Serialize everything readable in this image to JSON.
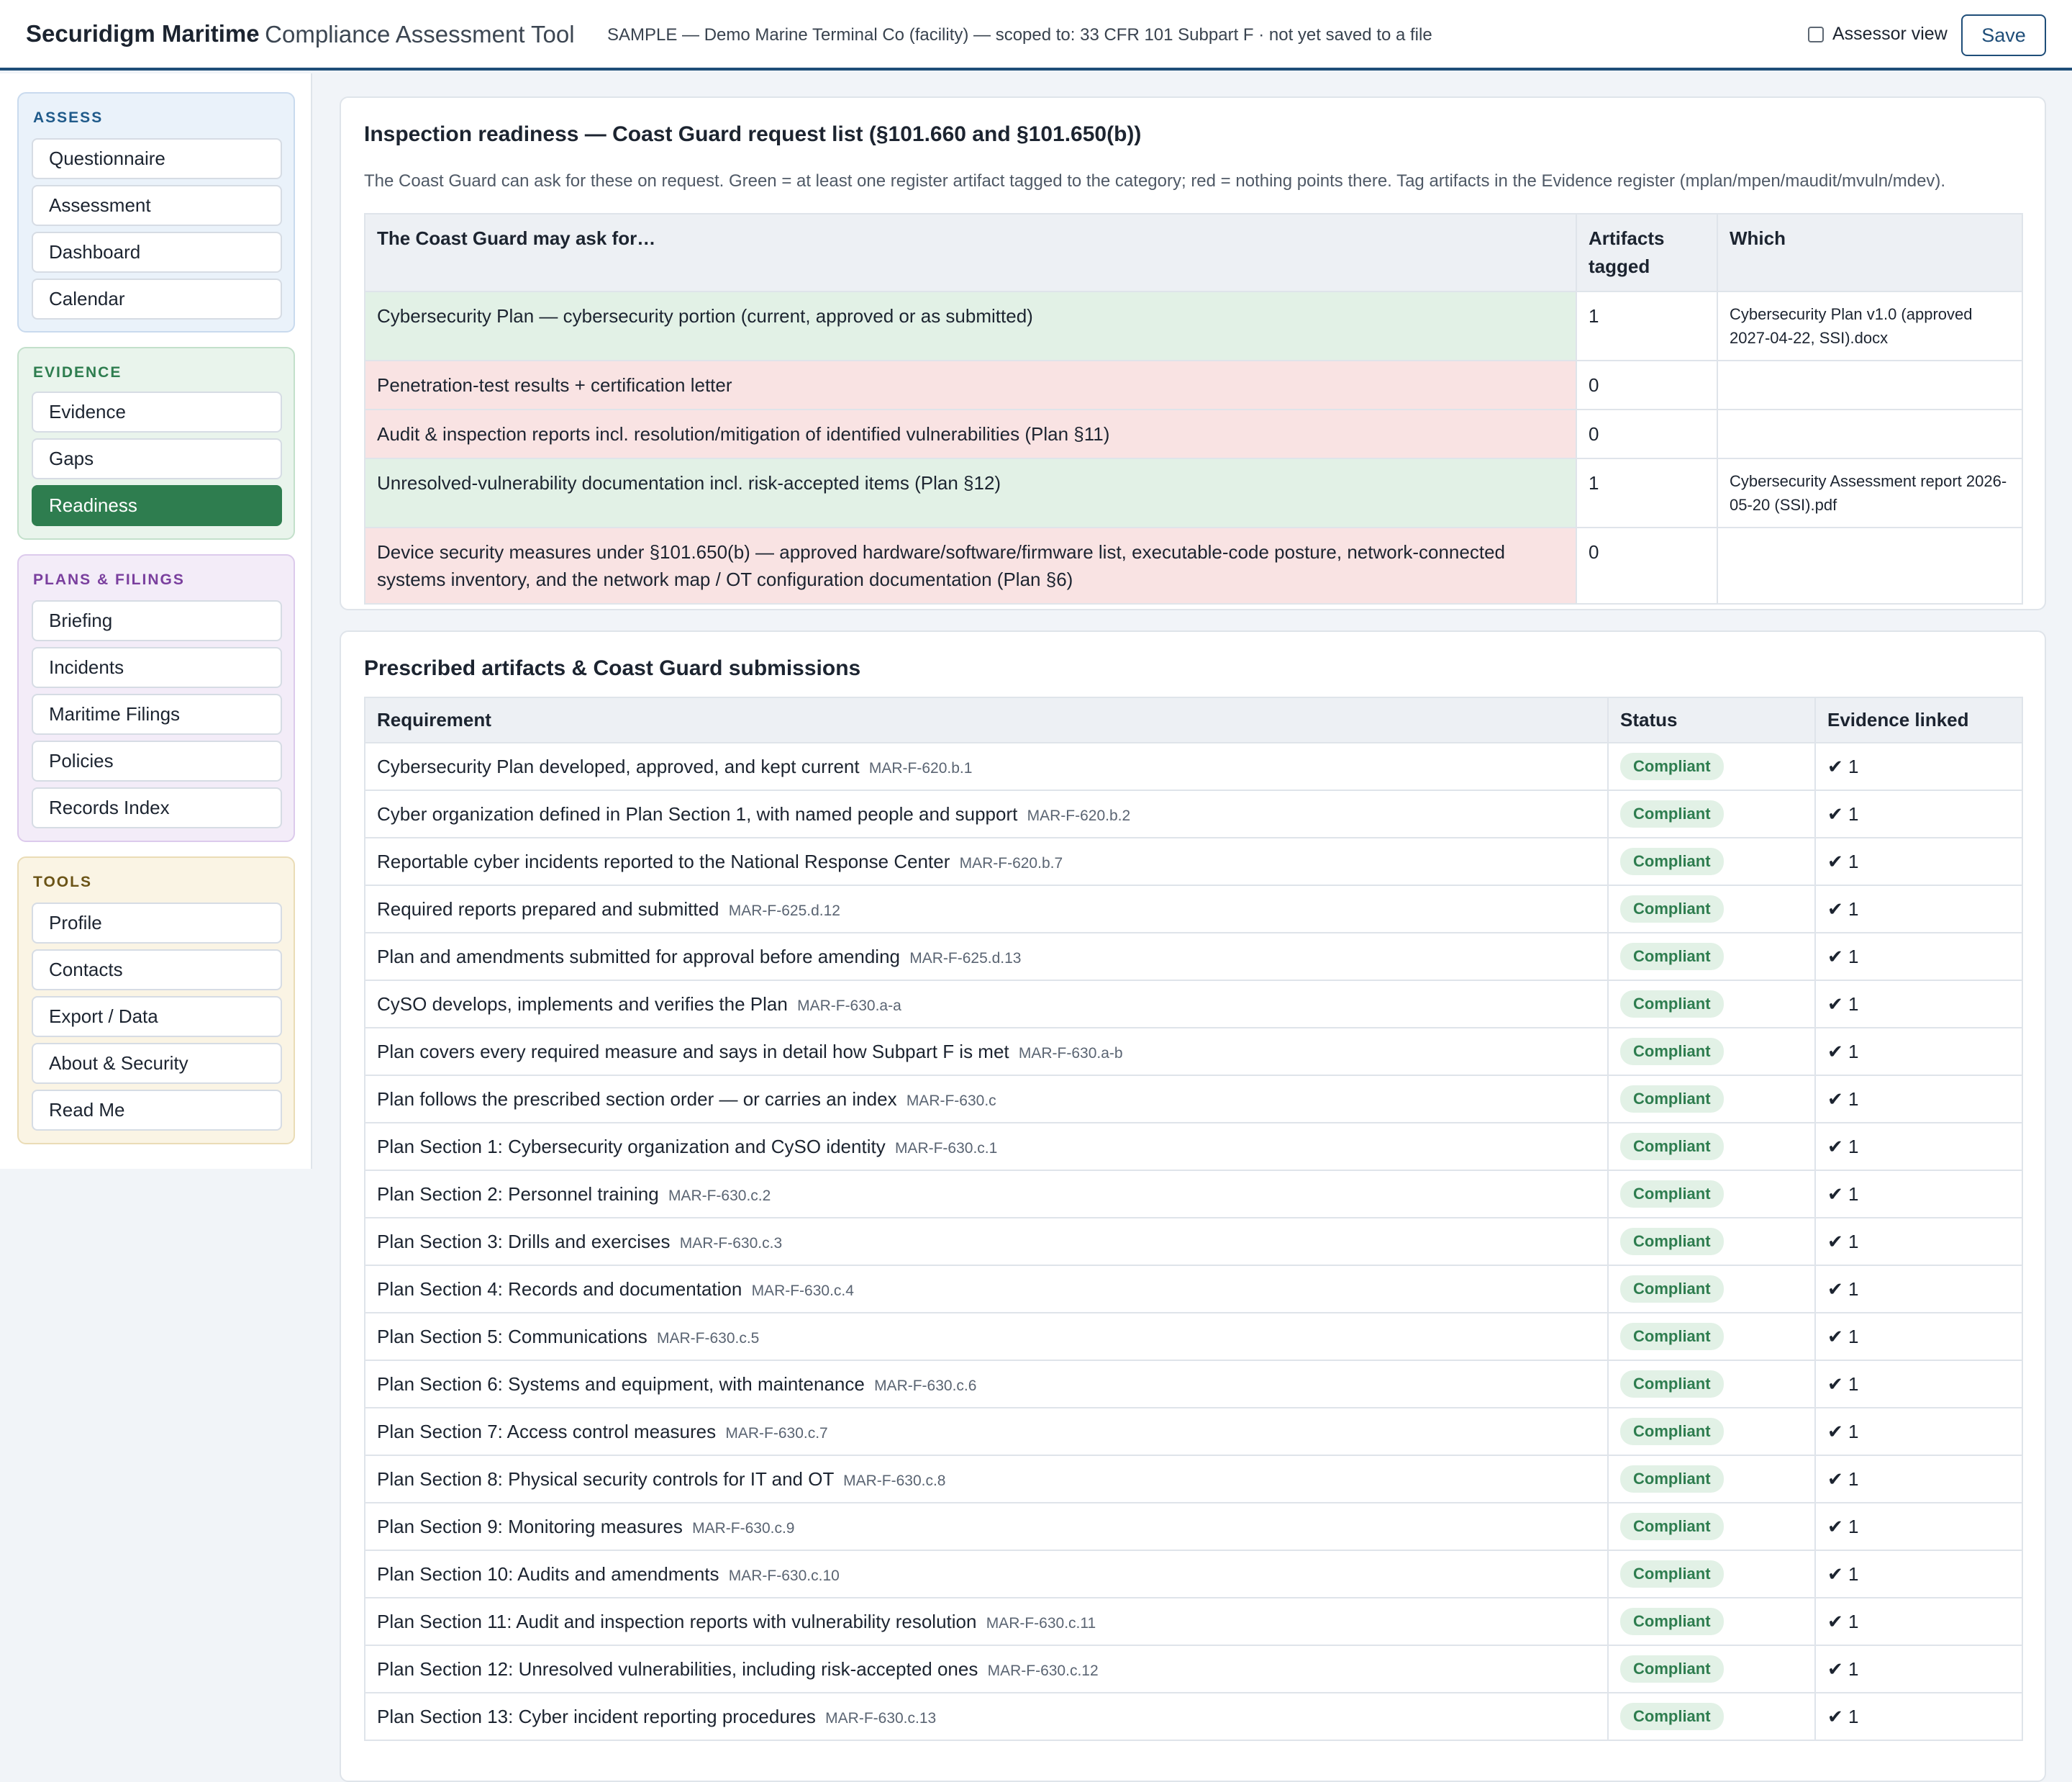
{
  "header": {
    "brand": "Securidigm Maritime",
    "brand_sub": "· Compliance Assessment Tool",
    "scope": "SAMPLE — Demo Marine Terminal Co (facility) — scoped to: 33 CFR 101 Subpart F · not yet saved to a file",
    "assessor_label": "Assessor view",
    "save_label": "Save"
  },
  "sidebar": {
    "assess": {
      "title": "ASSESS",
      "items": [
        "Questionnaire",
        "Assessment",
        "Dashboard",
        "Calendar"
      ]
    },
    "evidence": {
      "title": "EVIDENCE",
      "items": [
        "Evidence",
        "Gaps",
        "Readiness"
      ]
    },
    "plans": {
      "title": "PLANS & FILINGS",
      "items": [
        "Briefing",
        "Incidents",
        "Maritime Filings",
        "Policies",
        "Records Index"
      ]
    },
    "tools": {
      "title": "TOOLS",
      "items": [
        "Profile",
        "Contacts",
        "Export / Data",
        "About & Security",
        "Read Me"
      ]
    },
    "active": "Readiness"
  },
  "readiness": {
    "title": "Inspection readiness — Coast Guard request list (§101.660 and §101.650(b))",
    "description": "The Coast Guard can ask for these on request. Green = at least one register artifact tagged to the category; red = nothing points there. Tag artifacts in the Evidence register (mplan/mpen/maudit/mvuln/mdev).",
    "headers": [
      "The Coast Guard may ask for…",
      "Artifacts tagged",
      "Which"
    ],
    "rows": [
      {
        "item": "Cybersecurity Plan — cybersecurity portion (current, approved or as submitted)",
        "count": "1",
        "which": "Cybersecurity Plan v1.0 (approved 2027-04-22, SSI).docx",
        "status": "ok"
      },
      {
        "item": "Penetration-test results + certification letter",
        "count": "0",
        "which": "",
        "status": "miss"
      },
      {
        "item": "Audit & inspection reports incl. resolution/mitigation of identified vulnerabilities (Plan §11)",
        "count": "0",
        "which": "",
        "status": "miss"
      },
      {
        "item": "Unresolved-vulnerability documentation incl. risk-accepted items (Plan §12)",
        "count": "1",
        "which": "Cybersecurity Assessment report 2026-05-20 (SSI).pdf",
        "status": "ok"
      },
      {
        "item": "Device security measures under §101.650(b) — approved hardware/software/firmware list, executable-code posture, network-connected systems inventory, and the network map / OT configuration documentation (Plan §6)",
        "count": "0",
        "which": "",
        "status": "miss"
      }
    ]
  },
  "prescribed": {
    "title": "Prescribed artifacts & Coast Guard submissions",
    "headers": [
      "Requirement",
      "Status",
      "Evidence linked"
    ],
    "rows": [
      {
        "req": "Cybersecurity Plan developed, approved, and kept current",
        "code": "MAR-F-620.b.1",
        "status": "Compliant",
        "evidence": "✔ 1"
      },
      {
        "req": "Cyber organization defined in Plan Section 1, with named people and support",
        "code": "MAR-F-620.b.2",
        "status": "Compliant",
        "evidence": "✔ 1"
      },
      {
        "req": "Reportable cyber incidents reported to the National Response Center",
        "code": "MAR-F-620.b.7",
        "status": "Compliant",
        "evidence": "✔ 1"
      },
      {
        "req": "Required reports prepared and submitted",
        "code": "MAR-F-625.d.12",
        "status": "Compliant",
        "evidence": "✔ 1"
      },
      {
        "req": "Plan and amendments submitted for approval before amending",
        "code": "MAR-F-625.d.13",
        "status": "Compliant",
        "evidence": "✔ 1"
      },
      {
        "req": "CySO develops, implements and verifies the Plan",
        "code": "MAR-F-630.a-a",
        "status": "Compliant",
        "evidence": "✔ 1"
      },
      {
        "req": "Plan covers every required measure and says in detail how Subpart F is met",
        "code": "MAR-F-630.a-b",
        "status": "Compliant",
        "evidence": "✔ 1"
      },
      {
        "req": "Plan follows the prescribed section order — or carries an index",
        "code": "MAR-F-630.c",
        "status": "Compliant",
        "evidence": "✔ 1"
      },
      {
        "req": "Plan Section 1: Cybersecurity organization and CySO identity",
        "code": "MAR-F-630.c.1",
        "status": "Compliant",
        "evidence": "✔ 1"
      },
      {
        "req": "Plan Section 2: Personnel training",
        "code": "MAR-F-630.c.2",
        "status": "Compliant",
        "evidence": "✔ 1"
      },
      {
        "req": "Plan Section 3: Drills and exercises",
        "code": "MAR-F-630.c.3",
        "status": "Compliant",
        "evidence": "✔ 1"
      },
      {
        "req": "Plan Section 4: Records and documentation",
        "code": "MAR-F-630.c.4",
        "status": "Compliant",
        "evidence": "✔ 1"
      },
      {
        "req": "Plan Section 5: Communications",
        "code": "MAR-F-630.c.5",
        "status": "Compliant",
        "evidence": "✔ 1"
      },
      {
        "req": "Plan Section 6: Systems and equipment, with maintenance",
        "code": "MAR-F-630.c.6",
        "status": "Compliant",
        "evidence": "✔ 1"
      },
      {
        "req": "Plan Section 7: Access control measures",
        "code": "MAR-F-630.c.7",
        "status": "Compliant",
        "evidence": "✔ 1"
      },
      {
        "req": "Plan Section 8: Physical security controls for IT and OT",
        "code": "MAR-F-630.c.8",
        "status": "Compliant",
        "evidence": "✔ 1"
      },
      {
        "req": "Plan Section 9: Monitoring measures",
        "code": "MAR-F-630.c.9",
        "status": "Compliant",
        "evidence": "✔ 1"
      },
      {
        "req": "Plan Section 10: Audits and amendments",
        "code": "MAR-F-630.c.10",
        "status": "Compliant",
        "evidence": "✔ 1"
      },
      {
        "req": "Plan Section 11: Audit and inspection reports with vulnerability resolution",
        "code": "MAR-F-630.c.11",
        "status": "Compliant",
        "evidence": "✔ 1"
      },
      {
        "req": "Plan Section 12: Unresolved vulnerabilities, including risk-accepted ones",
        "code": "MAR-F-630.c.12",
        "status": "Compliant",
        "evidence": "✔ 1"
      },
      {
        "req": "Plan Section 13: Cyber incident reporting procedures",
        "code": "MAR-F-630.c.13",
        "status": "Compliant",
        "evidence": "✔ 1"
      }
    ]
  },
  "colors": {
    "accent": "#1f4e79",
    "active_nav": "#2e7d4f",
    "green_row": "#e2f1e6",
    "red_row": "#f9e3e3"
  }
}
